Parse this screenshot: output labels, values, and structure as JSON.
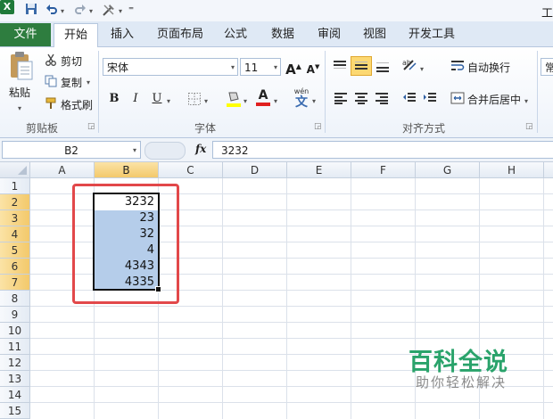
{
  "app": {
    "title_fragment": "工",
    "icon_letter": "X"
  },
  "ribbon_tabs": {
    "file": "文件",
    "items": [
      "开始",
      "插入",
      "页面布局",
      "公式",
      "数据",
      "审阅",
      "视图",
      "开发工具"
    ],
    "active": "开始"
  },
  "clipboard": {
    "paste": "粘贴",
    "cut": "剪切",
    "copy": "复制",
    "format_painter": "格式刷",
    "group_label": "剪贴板"
  },
  "font": {
    "name": "宋体",
    "size": "11",
    "bold": "B",
    "italic": "I",
    "underline": "U",
    "grow": "A",
    "shrink": "A",
    "font_color_glyph": "A",
    "phonetic_top": "wén",
    "phonetic_glyph": "文",
    "group_label": "字体",
    "highlight_color": "#ffff00",
    "font_color": "#e02020"
  },
  "alignment": {
    "wrap_text": "自动换行",
    "merge_center": "合并后居中",
    "group_label": "对齐方式"
  },
  "number": {
    "format_fragment": "常"
  },
  "formula_bar": {
    "name_box": "B2",
    "fx": "fx",
    "value": "3232"
  },
  "sheet": {
    "columns": [
      "A",
      "B",
      "C",
      "D",
      "E",
      "F",
      "G",
      "H"
    ],
    "rows": [
      "1",
      "2",
      "3",
      "4",
      "5",
      "6",
      "7",
      "8",
      "9",
      "10",
      "11",
      "12",
      "13",
      "14",
      "15"
    ],
    "selected_column": "B",
    "selected_rows": [
      "2",
      "3",
      "4",
      "5",
      "6",
      "7"
    ],
    "b_values": [
      "3232",
      "23",
      "32",
      "4",
      "4343",
      "4335"
    ]
  },
  "watermark": {
    "title": "百科全说",
    "subtitle": "助你轻松解决"
  },
  "colors": {
    "accent_green": "#2e7d3f",
    "selection_fill": "#b5cdea",
    "annotation_red": "#e2484a",
    "watermark_green": "#2aa36b"
  }
}
